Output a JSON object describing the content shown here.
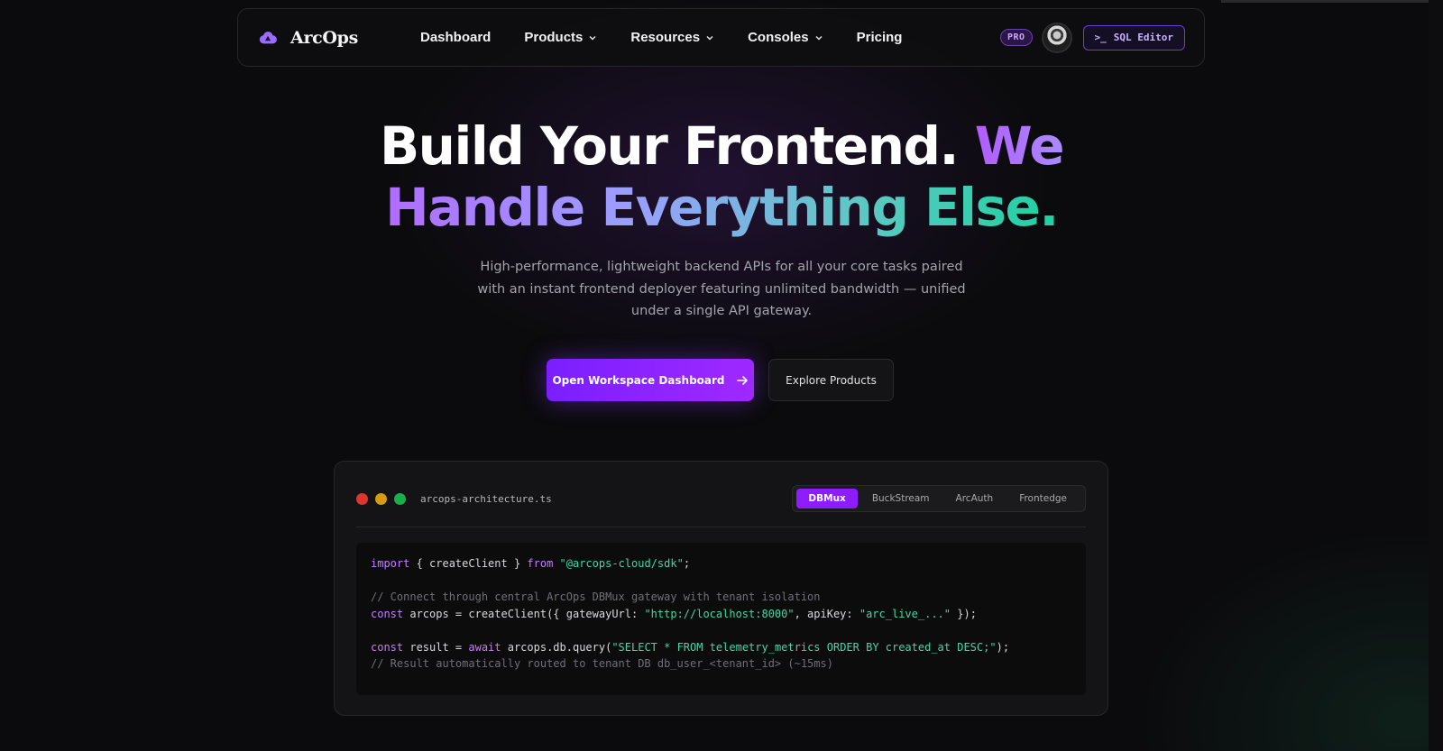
{
  "brand": {
    "name": "ArcOps"
  },
  "nav": {
    "items": [
      {
        "label": "Dashboard",
        "has_dropdown": false
      },
      {
        "label": "Products",
        "has_dropdown": true
      },
      {
        "label": "Resources",
        "has_dropdown": true
      },
      {
        "label": "Consoles",
        "has_dropdown": true
      },
      {
        "label": "Pricing",
        "has_dropdown": false
      }
    ],
    "pro_badge": "PRO",
    "sql_prompt": ">_",
    "sql_label": "SQL Editor"
  },
  "hero": {
    "title_white": "Build Your Frontend.",
    "title_we": "We",
    "title_line2": "Handle Everything Else.",
    "subtitle": "High-performance, lightweight backend APIs for all your core tasks paired with an instant frontend deployer featuring unlimited bandwidth — unified under a single API gateway.",
    "cta_primary": "Open Workspace Dashboard",
    "cta_secondary": "Explore Products"
  },
  "code_card": {
    "filename": "arcops-architecture.ts",
    "tabs": [
      {
        "label": "DBMux",
        "active": true
      },
      {
        "label": "BuckStream",
        "active": false
      },
      {
        "label": "ArcAuth",
        "active": false
      },
      {
        "label": "Frontedge",
        "active": false
      }
    ],
    "lines": {
      "l1_kw1": "import",
      "l1_mid": " { createClient } ",
      "l1_kw2": "from",
      "l1_sp": " ",
      "l1_str": "\"@arcops-cloud/sdk\"",
      "l1_end": ";",
      "l3_comment": "// Connect through central ArcOps DBMux gateway with tenant isolation",
      "l4_kw": "const",
      "l4_a": " arcops = createClient({ gatewayUrl: ",
      "l4_str1": "\"http://localhost:8000\"",
      "l4_b": ", apiKey: ",
      "l4_str2": "\"arc_live_...\"",
      "l4_c": " });",
      "l6_kw": "const",
      "l6_a": " result = ",
      "l6_kw2": "await",
      "l6_b": " arcops.db.query(",
      "l6_str": "\"SELECT * FROM telemetry_metrics ORDER BY created_at DESC;\"",
      "l6_c": ");",
      "l7_comment": "// Result automatically routed to tenant DB db_user_<tenant_id> (~15ms)"
    }
  },
  "colors": {
    "accent": "#8d1dff",
    "dot_red": "#e0342f",
    "dot_yellow": "#d79a12",
    "dot_green": "#16b14c"
  }
}
